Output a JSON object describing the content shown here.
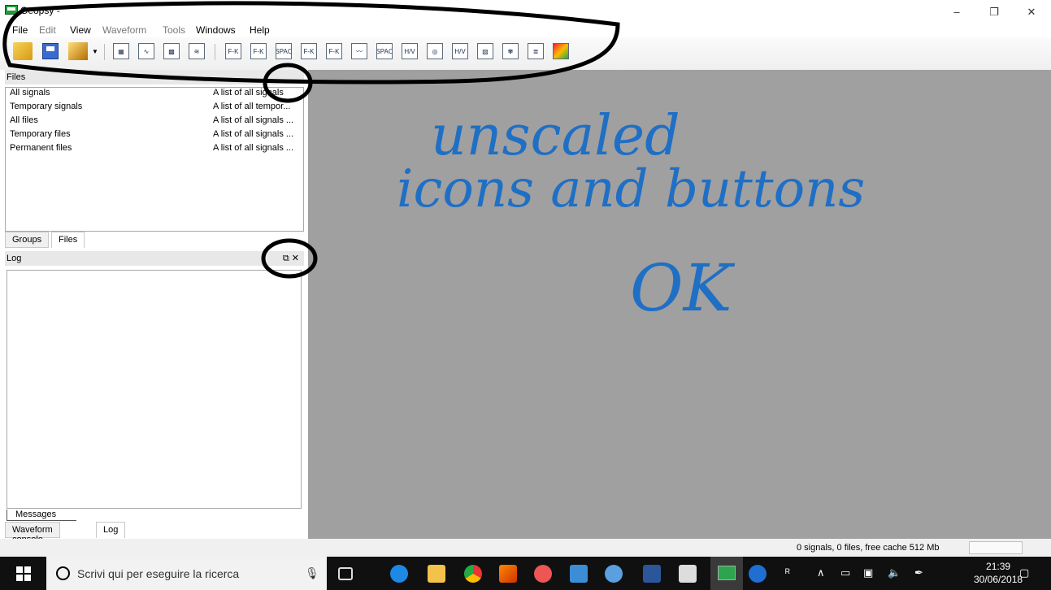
{
  "window": {
    "title": "Geopsy -"
  },
  "menu": [
    {
      "label": "File",
      "enabled": true
    },
    {
      "label": "Edit",
      "enabled": false
    },
    {
      "label": "View",
      "enabled": true
    },
    {
      "label": "Waveform",
      "enabled": false
    },
    {
      "label": "Tools",
      "enabled": false
    },
    {
      "label": "Windows",
      "enabled": true
    },
    {
      "label": "Help",
      "enabled": true
    }
  ],
  "toolbar_icons": {
    "fk1": "F-K",
    "fk2": "F-K",
    "spac1": "SPAC",
    "fk3": "F-K",
    "fk4": "F-K",
    "spac2": "SPAC",
    "hv1": "H/V",
    "hv2": "H/V"
  },
  "files_panel": {
    "title": "Files",
    "rows": [
      {
        "name": "All signals",
        "desc": "A list of all signals"
      },
      {
        "name": "Temporary signals",
        "desc": "A list of all tempor..."
      },
      {
        "name": "All files",
        "desc": "A list of all signals ..."
      },
      {
        "name": "Temporary files",
        "desc": "A list of all signals ..."
      },
      {
        "name": "Permanent files",
        "desc": "A list of all signals ..."
      }
    ],
    "tabs": [
      "Groups",
      "Files"
    ]
  },
  "log_panel": {
    "title": "Log",
    "float_icon": "⧉",
    "close_icon": "✕",
    "messages_tab": "Messages",
    "tabs": [
      "Waveform console",
      "Log"
    ]
  },
  "status": {
    "text": "0 signals, 0 files, free cache 512 Mb"
  },
  "taskbar": {
    "search_placeholder": "Scrivi qui per eseguire la ricerca",
    "time": "21:39",
    "date": "30/06/2018"
  },
  "annotation": {
    "line1": "unscaled",
    "line2": "icons and buttons",
    "line3": "OK",
    "color": "#1f6fc5"
  }
}
